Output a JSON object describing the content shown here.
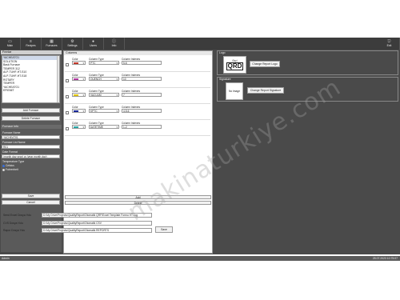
{
  "toolbar": {
    "items": [
      {
        "label": "Main",
        "icon": "monitor-icon"
      },
      {
        "label": "Recipes",
        "icon": "list-icon"
      },
      {
        "label": "Furnaces",
        "icon": "furnace-icon"
      },
      {
        "label": "Settings",
        "icon": "gear-icon"
      },
      {
        "label": "Users",
        "icon": "user-icon"
      },
      {
        "label": "Info",
        "icon": "info-icon"
      }
    ],
    "exit_label": "Exit"
  },
  "furnaces": {
    "header": "Fırınlar",
    "items": [
      "YACHEATO1",
      "SOLUTION",
      "Bask Furnace",
      "TEMPER 312",
      "ALP-TUHF-HT-S10",
      "ALP-TUHF-HT-S18",
      "ROTARY",
      "TEMPER",
      "YACHEATO1",
      "EPIEMIT"
    ],
    "selected_index": 0,
    "add_label": "Add Furnace",
    "delete_label": "Delete Furnace"
  },
  "furnace_info": {
    "header": "Furnace Info",
    "name_label": "Furnace Name",
    "name_value": "YACHEAT01",
    "list_name_label": "Furnace List Name",
    "list_name_value": "R01",
    "date_format_label": "Date Format",
    "date_format_value": "(month day year) or (year month day)",
    "temp_type_label": "Temperature Type",
    "celsius_label": "Celsius",
    "fahrenheit_label": "Fahrenheit",
    "save_label": "Save",
    "cancel_label": "Cancel"
  },
  "columns": {
    "header": "Columns",
    "color_label": "Color",
    "type_label": "Column Type",
    "indexes_label": "Column Indexes",
    "rows": [
      {
        "color": "#c0392b",
        "type": "PTC",
        "indexes": "5-6"
      },
      {
        "color": "#b03aa0",
        "type": "QUENCH",
        "indexes": "10"
      },
      {
        "color": "#e0c400",
        "type": "VACUUM",
        "indexes": "7"
      },
      {
        "color": "#1a2a9a",
        "type": "KPTC",
        "indexes": "4-5-6"
      },
      {
        "color": "#2aa6a6",
        "type": "DATETIME",
        "indexes": "1-2"
      }
    ],
    "add_label": "Add",
    "delete_label": "Delete"
  },
  "logo": {
    "header": "Logo",
    "logo_text_top": "Bayi",
    "logo_text_main": "QRD",
    "change_logo_label": "Change Report Logo",
    "signature_header": "Signature",
    "no_image_label": "No image",
    "change_signature_label": "Change Report Signature"
  },
  "paths": {
    "excel_label": "Send Excel Dosya Yolu",
    "excel_value": "D:\\My Drive\\Projects\\QualityReport\\Otomatik QRF\\Excel Template Formu HT.Log",
    "csv_label": "CVS Dosya Yolu",
    "csv_value": "D:\\My Drive\\Projects\\QualityReport\\Otomatik CSV",
    "report_label": "Rapor Dosya Yolu",
    "report_value": "D:\\My Drive\\Projects\\QualityReport\\Otomatik REPORTS",
    "save_label": "Save"
  },
  "status": {
    "user": "Admin",
    "datetime": "25.07.2023 10:75:07"
  },
  "watermark": "makinaturkiye.com"
}
